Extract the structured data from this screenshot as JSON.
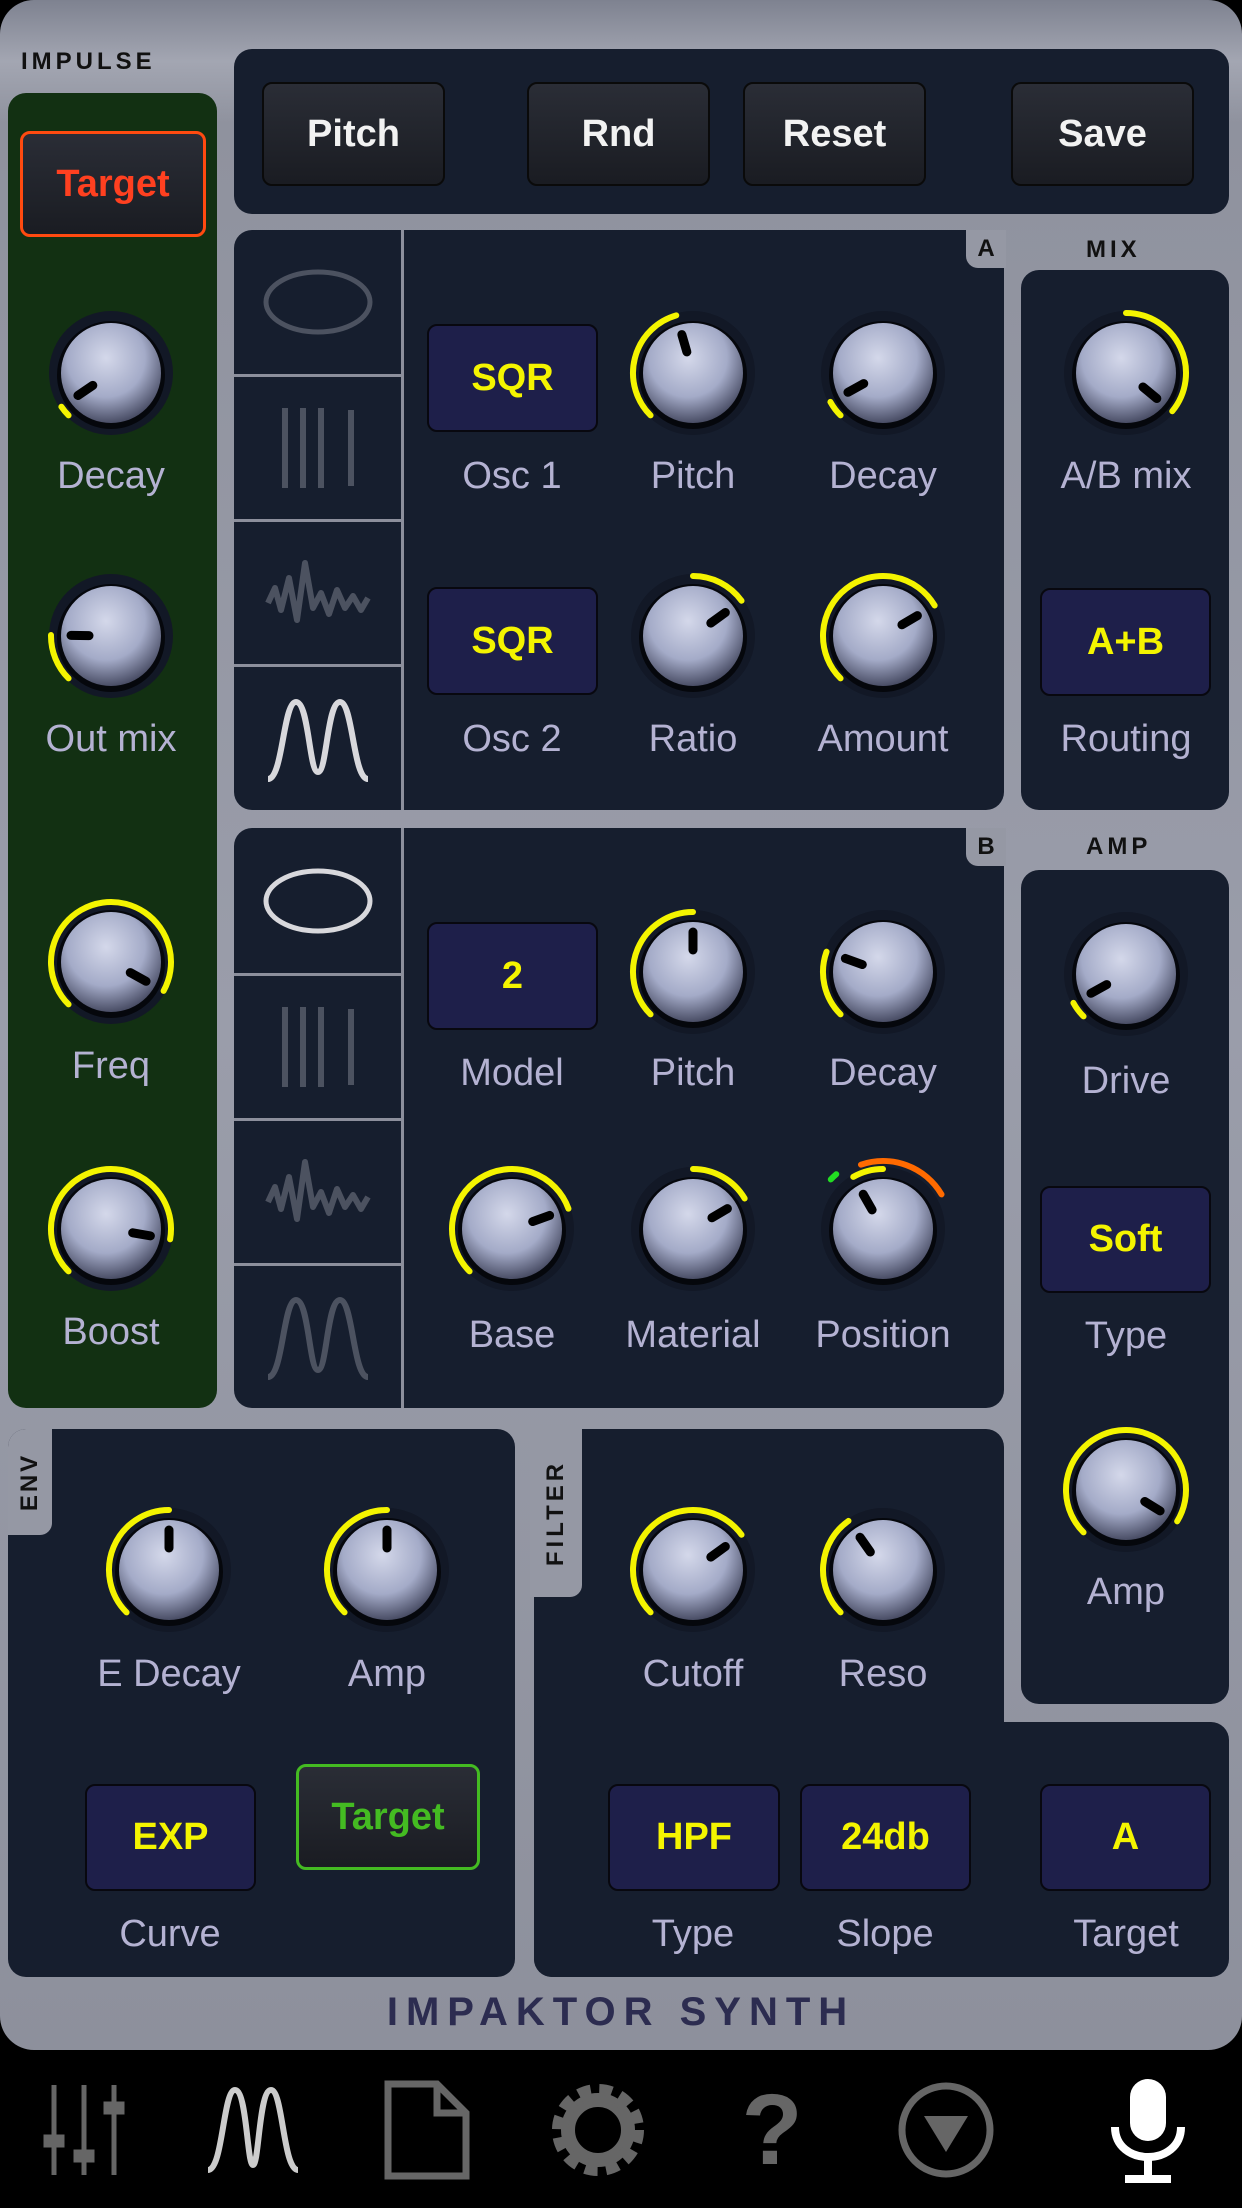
{
  "sections": {
    "impulse": "IMPULSE",
    "a": "A",
    "mix": "MIX",
    "b": "B",
    "amp": "AMP",
    "env": "ENV",
    "filter": "FILTER"
  },
  "toolbar": {
    "pitch": "Pitch",
    "rnd": "Rnd",
    "reset": "Reset",
    "save": "Save"
  },
  "impulse": {
    "target": "Target",
    "decay": "Decay",
    "out_mix": "Out mix",
    "freq": "Freq",
    "boost": "Boost"
  },
  "osc_a": {
    "osc1_value": "SQR",
    "osc1": "Osc 1",
    "pitch": "Pitch",
    "decay": "Decay",
    "osc2_value": "SQR",
    "osc2": "Osc 2",
    "ratio": "Ratio",
    "amount": "Amount",
    "selected_wave": 3
  },
  "mix": {
    "ab_mix": "A/B mix",
    "routing_value": "A+B",
    "routing": "Routing"
  },
  "osc_b": {
    "model_value": "2",
    "model": "Model",
    "pitch": "Pitch",
    "decay": "Decay",
    "base": "Base",
    "material": "Material",
    "position": "Position",
    "selected_wave": 0
  },
  "amp": {
    "drive": "Drive",
    "type_value": "Soft",
    "type": "Type",
    "amp": "Amp"
  },
  "env": {
    "e_decay": "E Decay",
    "amp": "Amp",
    "curve_value": "EXP",
    "curve": "Curve",
    "target": "Target"
  },
  "filter": {
    "cutoff": "Cutoff",
    "reso": "Reso",
    "type_value": "HPF",
    "type": "Type",
    "slope_value": "24db",
    "slope": "Slope",
    "target_value": "A",
    "target": "Target"
  },
  "footer": {
    "title": "IMPAKTOR SYNTH"
  },
  "knobs": {
    "impulse_decay": {
      "value": 0.04,
      "bipolar": false
    },
    "impulse_out_mix": {
      "value": 0.17,
      "bipolar": false
    },
    "impulse_freq": {
      "value": 0.94,
      "bipolar": false
    },
    "impulse_boost": {
      "value": 0.87,
      "bipolar": false
    },
    "a_pitch": {
      "value": 0.44,
      "bipolar": false
    },
    "a_decay": {
      "value": 0.06,
      "bipolar": false
    },
    "a_ratio": {
      "value": 0.7,
      "bipolar": true
    },
    "a_amount": {
      "value": 0.72,
      "bipolar": false
    },
    "ab_mix": {
      "value": 0.98,
      "bipolar": true
    },
    "b_pitch": {
      "value": 0.5,
      "bipolar": false
    },
    "b_decay": {
      "value": 0.24,
      "bipolar": false
    },
    "b_base": {
      "value": 0.76,
      "bipolar": false
    },
    "b_material": {
      "value": 0.72,
      "bipolar": true
    },
    "b_position": {
      "value": 0.39,
      "bipolar": true,
      "mod_range": [
        0.43,
        0.72
      ],
      "mod_marker": 0.35
    },
    "amp_drive": {
      "value": 0.06,
      "bipolar": false
    },
    "amp_amp": {
      "value": 0.95,
      "bipolar": false
    },
    "env_e_decay": {
      "value": 0.5,
      "bipolar": false
    },
    "env_amp": {
      "value": 0.5,
      "bipolar": false
    },
    "filter_cutoff": {
      "value": 0.7,
      "bipolar": false
    },
    "filter_reso": {
      "value": 0.37,
      "bipolar": false
    }
  },
  "colors": {
    "arc": "#f4f400",
    "mod": "#ff6a00",
    "marker": "#22dd22",
    "target_red": "#ff4020",
    "target_green": "#44bb22"
  },
  "bottom_nav": [
    "mixer-icon",
    "wave-icon",
    "document-icon",
    "gear-icon",
    "help-icon",
    "dropdown-icon",
    "microphone-icon"
  ]
}
